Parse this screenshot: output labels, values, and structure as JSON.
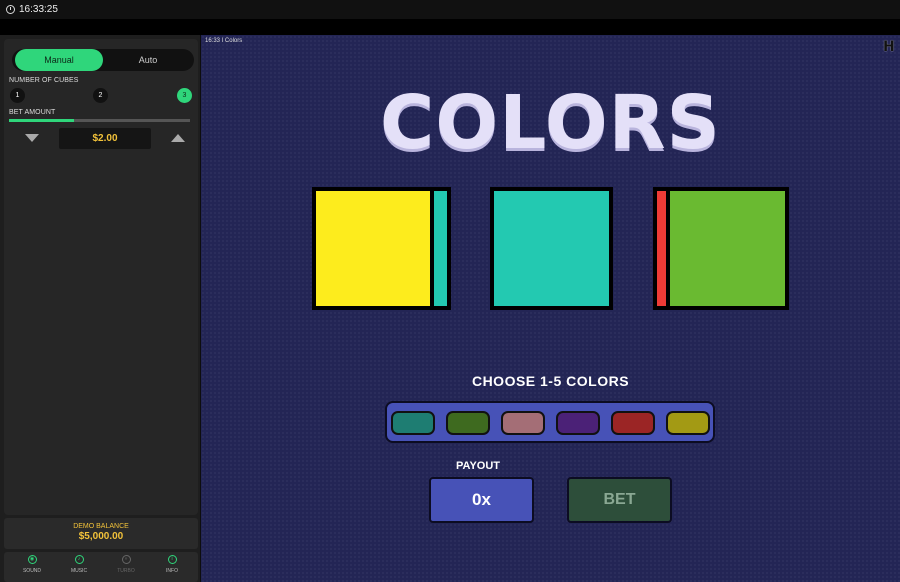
{
  "topbar": {
    "time": "16:33:25"
  },
  "sidebar": {
    "tabs": [
      {
        "label": "Manual"
      },
      {
        "label": "Auto"
      }
    ],
    "num_cubes_label": "NUMBER OF CUBES",
    "cube_options": [
      "1",
      "2",
      "3"
    ],
    "selected_cubes": "3",
    "bet_amount_label": "BET AMOUNT",
    "bet_amount": "$2.00",
    "bet_slider_fraction": 0.36,
    "balance_label": "DEMO BALANCE",
    "balance_value": "$5,000.00",
    "controls": [
      {
        "label": "SOUND",
        "icon": "sound-icon",
        "enabled": true
      },
      {
        "label": "MUSIC",
        "icon": "music-icon",
        "enabled": true
      },
      {
        "label": "TURBO",
        "icon": "turbo-icon",
        "enabled": false
      },
      {
        "label": "INFO",
        "icon": "info-icon",
        "enabled": true
      }
    ]
  },
  "game": {
    "header": "16:33 ǀ Colors",
    "title": "COLORS",
    "cubes": [
      {
        "front": "#fdec1d",
        "side": "#23c9b1",
        "side_position": "right"
      },
      {
        "front": "#23c9b1",
        "side": null,
        "side_position": "none"
      },
      {
        "front": "#6aba31",
        "side": "#ee3b36",
        "side_position": "left"
      }
    ],
    "choose_label": "CHOOSE 1-5 COLORS",
    "palette": [
      "#1e7d72",
      "#3e6a1f",
      "#a46e76",
      "#4b2177",
      "#9b2525",
      "#a39a14"
    ],
    "payout_label": "PAYOUT",
    "payout_value": "0x",
    "bet_button_label": "BET"
  },
  "colors": {
    "accent": "#2fd67b",
    "gold": "#f2c23a",
    "game_bg": "#232555",
    "panel_blue": "#4752b7"
  }
}
